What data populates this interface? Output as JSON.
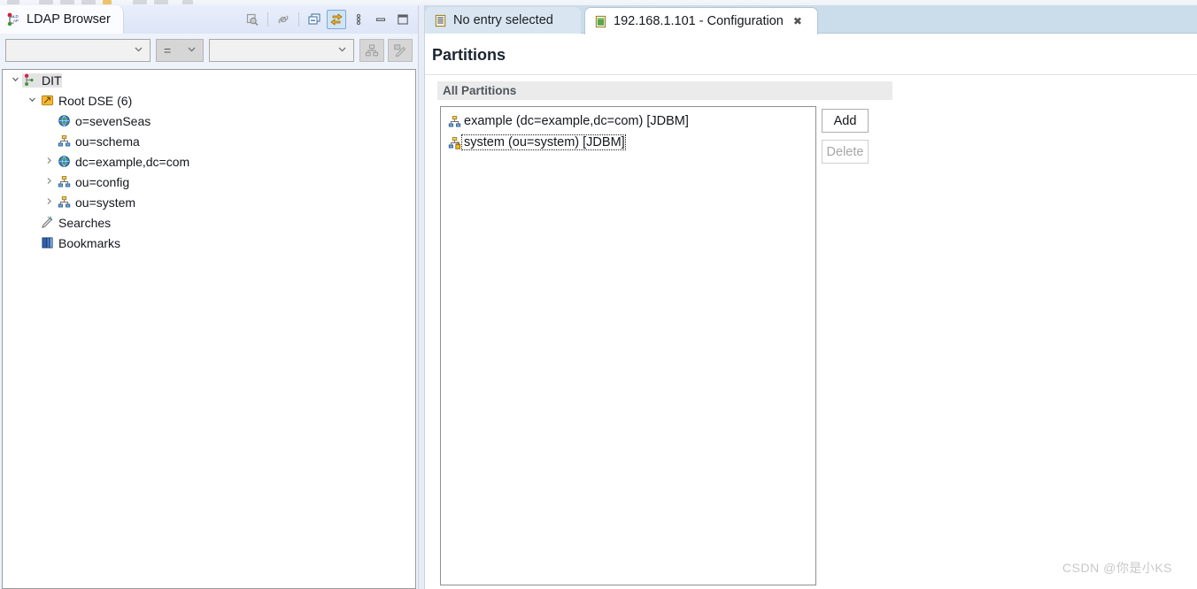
{
  "window": {
    "top_toolbar_cut_off": true
  },
  "ldap_view": {
    "tab_label": "LDAP Browser",
    "tab_icon": "ldap-browser-icon",
    "toolbar_icons": [
      {
        "name": "refresh-search-icon",
        "enabled": false,
        "active": false
      },
      {
        "name": "link-icon",
        "enabled": false,
        "active": false
      },
      {
        "name": "collapse-all-icon",
        "enabled": true,
        "active": false
      },
      {
        "name": "link-with-editor-icon",
        "enabled": true,
        "active": true
      },
      {
        "name": "view-menu-icon",
        "enabled": true,
        "active": false
      },
      {
        "name": "minimize-icon",
        "enabled": true,
        "active": false
      },
      {
        "name": "maximize-icon",
        "enabled": true,
        "active": false
      }
    ],
    "filter_bar": {
      "attribute_combo_value": "",
      "operator_combo_value": "=",
      "value_combo_value": "",
      "buttons": [
        {
          "name": "show-dit-button",
          "enabled": false
        },
        {
          "name": "edit-filter-button",
          "enabled": false
        }
      ]
    },
    "tree": [
      {
        "label": "DIT",
        "icon": "dit-icon",
        "indent": 0,
        "twisty": "expanded",
        "selected": true
      },
      {
        "label": "Root DSE (6)",
        "icon": "root-dse-icon",
        "indent": 1,
        "twisty": "expanded",
        "selected": false
      },
      {
        "label": "o=sevenSeas",
        "icon": "globe-entry-icon",
        "indent": 2,
        "twisty": "none",
        "selected": false
      },
      {
        "label": "ou=schema",
        "icon": "org-unit-icon",
        "indent": 2,
        "twisty": "none",
        "selected": false
      },
      {
        "label": "dc=example,dc=com",
        "icon": "globe-entry-icon",
        "indent": 2,
        "twisty": "collapsed",
        "selected": false
      },
      {
        "label": "ou=config",
        "icon": "org-unit-icon",
        "indent": 2,
        "twisty": "collapsed",
        "selected": false
      },
      {
        "label": "ou=system",
        "icon": "org-unit-icon",
        "indent": 2,
        "twisty": "collapsed",
        "selected": false
      },
      {
        "label": "Searches",
        "icon": "searches-icon",
        "indent": 1,
        "twisty": "none",
        "selected": false
      },
      {
        "label": "Bookmarks",
        "icon": "bookmarks-icon",
        "indent": 1,
        "twisty": "none",
        "selected": false
      }
    ]
  },
  "editor": {
    "tabs": [
      {
        "label": "No entry selected",
        "icon": "entry-editor-icon",
        "active": false,
        "closable": false
      },
      {
        "label": "192.168.1.101 - Configuration",
        "icon": "configuration-editor-icon",
        "active": true,
        "closable": true
      }
    ],
    "close_glyph": "✖",
    "form_title": "Partitions",
    "section_header": "All Partitions",
    "partitions": [
      {
        "label": "example (dc=example,dc=com) [JDBM]",
        "icon": "partition-icon",
        "focused": false
      },
      {
        "label": "system (ou=system) [JDBM]",
        "icon": "partition-locked-icon",
        "focused": true
      }
    ],
    "buttons": [
      {
        "name": "add-button",
        "label": "Add",
        "enabled": true
      },
      {
        "name": "delete-button",
        "label": "Delete",
        "enabled": false
      }
    ]
  },
  "watermark": "CSDN @你是小KS",
  "colors": {
    "tab_bar": "#cbdcea",
    "active_tab": "#ffffff",
    "highlight": "#cfe4f7",
    "section_band": "#ebebeb",
    "selection": "#e3e3e3"
  }
}
